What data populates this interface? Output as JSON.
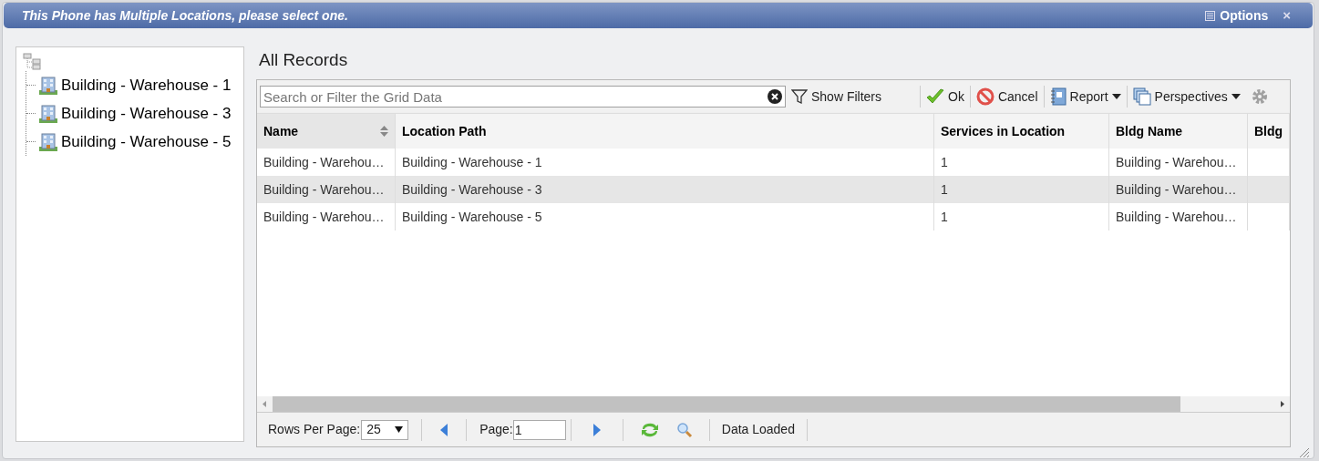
{
  "window": {
    "title": "This Phone has Multiple Locations, please select one.",
    "options_label": "Options",
    "close_label": "×"
  },
  "tree": {
    "items": [
      {
        "label": "Building - Warehouse - 1"
      },
      {
        "label": "Building - Warehouse - 3"
      },
      {
        "label": "Building - Warehouse - 5"
      }
    ]
  },
  "grid": {
    "title": "All Records",
    "search": {
      "placeholder": "Search or Filter the Grid Data"
    },
    "toolbar": [
      {
        "kind": "filter",
        "label": "Show Filters"
      },
      {
        "kind": "ok",
        "label": "Ok"
      },
      {
        "kind": "cancel",
        "label": "Cancel"
      },
      {
        "kind": "report",
        "label": "Report"
      },
      {
        "kind": "perspectives",
        "label": "Perspectives"
      },
      {
        "kind": "settings"
      }
    ],
    "columns": [
      "Name",
      "Location Path",
      "Services in Location",
      "Bldg Name",
      "Bldg"
    ],
    "rows": [
      {
        "selected": false,
        "cells": [
          "Building - Warehou…",
          "Building - Warehouse - 1",
          "1",
          "Building - Warehou…",
          ""
        ]
      },
      {
        "selected": true,
        "cells": [
          "Building - Warehou…",
          "Building - Warehouse - 3",
          "1",
          "Building - Warehou…",
          ""
        ]
      },
      {
        "selected": false,
        "cells": [
          "Building - Warehou…",
          "Building - Warehouse - 5",
          "1",
          "Building - Warehou…",
          ""
        ]
      }
    ],
    "footer": {
      "rows_per_page_label": "Rows Per Page:",
      "rows_per_page": "25",
      "page_label": "Page:",
      "page": "1",
      "status": "Data Loaded"
    }
  }
}
